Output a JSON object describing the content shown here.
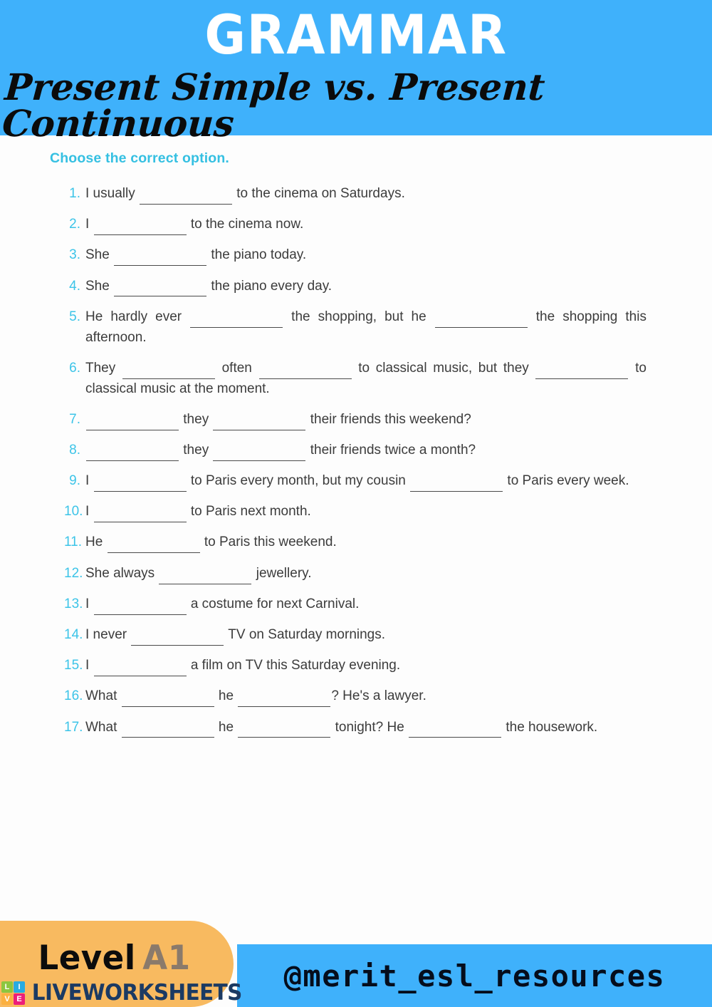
{
  "header": {
    "title": "GRAMMAR",
    "subtitle": "Present Simple vs. Present Continuous",
    "background_color": "#3fb1fb",
    "title_color": "#ffffff",
    "subtitle_color": "#0b0b0b"
  },
  "instruction": {
    "text": "Choose the correct option.",
    "color": "#35c0e2"
  },
  "exercise": {
    "number_color": "#3cc4e8",
    "text_color": "#3c3c3c",
    "items": [
      {
        "number": "1.",
        "justify": false,
        "parts": [
          "I usually ",
          "BLANK",
          " to the cinema on Saturdays."
        ]
      },
      {
        "number": "2.",
        "justify": false,
        "parts": [
          "I ",
          "BLANK",
          " to the cinema now."
        ]
      },
      {
        "number": "3.",
        "justify": false,
        "parts": [
          "She ",
          "BLANK",
          " the piano today."
        ]
      },
      {
        "number": "4.",
        "justify": false,
        "parts": [
          "She ",
          "BLANK",
          " the piano every day."
        ]
      },
      {
        "number": "5.",
        "justify": true,
        "parts": [
          "He hardly ever ",
          "BLANK",
          " the shopping, but he ",
          "BLANK",
          " the shopping this afternoon."
        ]
      },
      {
        "number": "6.",
        "justify": true,
        "parts": [
          "They ",
          "BLANK",
          " often ",
          "BLANK",
          " to classical music, but they ",
          "BLANK",
          " to classical music at the moment."
        ]
      },
      {
        "number": "7.",
        "justify": false,
        "parts": [
          "",
          "BLANK",
          " they ",
          "BLANK",
          " their friends this weekend?"
        ]
      },
      {
        "number": "8.",
        "justify": false,
        "parts": [
          "",
          "BLANK",
          " they ",
          "BLANK",
          " their friends twice a month?"
        ]
      },
      {
        "number": "9.",
        "justify": true,
        "parts": [
          "I ",
          "BLANK",
          " to Paris every month, but my cousin ",
          "BLANK",
          " to Paris every week."
        ]
      },
      {
        "number": "10.",
        "justify": false,
        "parts": [
          "I ",
          "BLANK",
          " to Paris next month."
        ]
      },
      {
        "number": "11.",
        "justify": false,
        "parts": [
          "He ",
          "BLANK",
          " to Paris this weekend."
        ]
      },
      {
        "number": "12.",
        "justify": false,
        "parts": [
          "She always ",
          "BLANK",
          " jewellery."
        ]
      },
      {
        "number": "13.",
        "justify": false,
        "parts": [
          "I ",
          "BLANK",
          " a costume for next Carnival."
        ]
      },
      {
        "number": "14.",
        "justify": false,
        "parts": [
          "I never ",
          "BLANK",
          " TV on Saturday mornings."
        ]
      },
      {
        "number": "15.",
        "justify": false,
        "parts": [
          "I ",
          "BLANK",
          " a film on TV this Saturday evening."
        ]
      },
      {
        "number": "16.",
        "justify": false,
        "parts": [
          "What ",
          "BLANK",
          " he ",
          "BLANK",
          "? He's a lawyer."
        ]
      },
      {
        "number": "17.",
        "justify": true,
        "parts": [
          "What ",
          "BLANK",
          " he ",
          "BLANK",
          " tonight? He ",
          "BLANK",
          " the housework."
        ]
      }
    ]
  },
  "footer": {
    "level_word": "Level",
    "level_code": "A1",
    "handle": "@merit_esl_resources",
    "watermark": {
      "tiles": [
        "L",
        "I",
        "V",
        "E"
      ],
      "word": "LIVEWORKSHEETS"
    },
    "pill_color": "#f8ba60",
    "band_color": "#3fb1fb"
  }
}
